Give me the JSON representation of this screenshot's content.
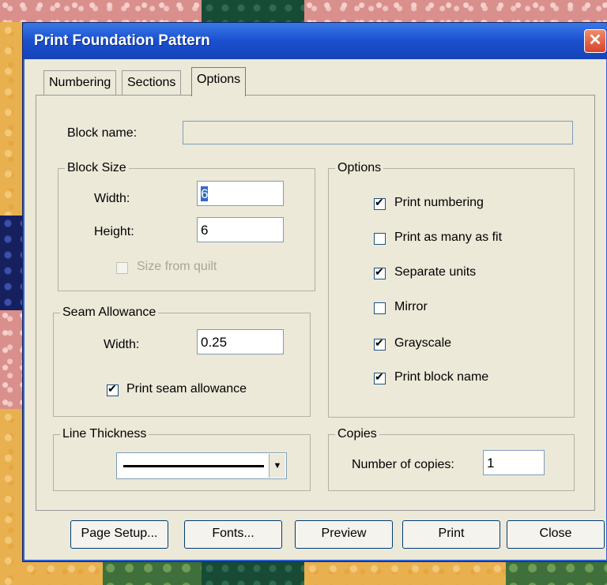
{
  "window": {
    "title": "Print Foundation Pattern",
    "close_glyph": "✕"
  },
  "tabs": [
    {
      "label": "Numbering",
      "active": false
    },
    {
      "label": "Sections",
      "active": false
    },
    {
      "label": "Options",
      "active": true
    }
  ],
  "block_name": {
    "label": "Block name:",
    "value": ""
  },
  "block_size": {
    "legend": "Block Size",
    "width_label": "Width:",
    "width_value": "6",
    "height_label": "Height:",
    "height_value": "6",
    "size_from_quilt_label": "Size from quilt",
    "size_from_quilt_checked": false,
    "size_from_quilt_enabled": false
  },
  "seam_allowance": {
    "legend": "Seam Allowance",
    "width_label": "Width:",
    "width_value": "0.25",
    "print_label": "Print seam allowance",
    "print_checked": true
  },
  "line_thickness": {
    "legend": "Line Thickness"
  },
  "options": {
    "legend": "Options",
    "items": [
      {
        "label": "Print numbering",
        "checked": true
      },
      {
        "label": "Print as many as fit",
        "checked": false
      },
      {
        "label": "Separate units",
        "checked": true
      },
      {
        "label": "Mirror",
        "checked": false
      },
      {
        "label": "Grayscale",
        "checked": true
      },
      {
        "label": "Print block name",
        "checked": true
      }
    ]
  },
  "copies": {
    "legend": "Copies",
    "label": "Number of copies:",
    "value": "1"
  },
  "buttons": {
    "page_setup": "Page Setup...",
    "fonts": "Fonts...",
    "preview": "Preview",
    "print": "Print",
    "close": "Close"
  },
  "colors": {
    "titlebar": "#1b4fcf",
    "dialog_bg": "#ece9d8",
    "selection": "#316ac5"
  }
}
